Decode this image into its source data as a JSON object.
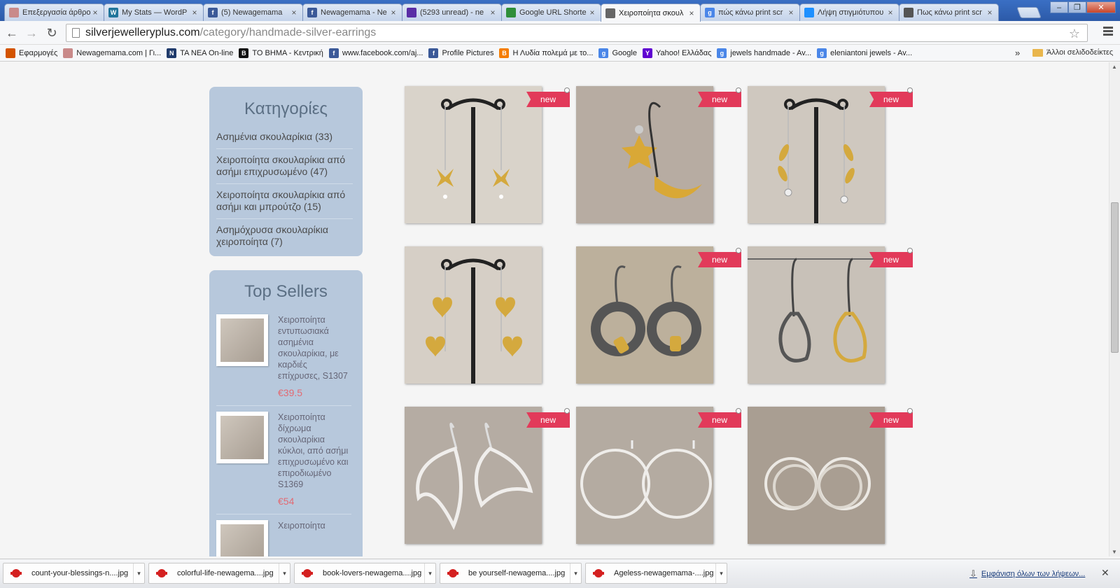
{
  "browser": {
    "tabs": [
      {
        "title": "Επεξεργασία άρθρο",
        "favicon_color": "#c98a8a"
      },
      {
        "title": "My Stats — WordP",
        "favicon_color": "#21759b",
        "favicon_text": "W"
      },
      {
        "title": "(5) Newagemama",
        "favicon_color": "#3b5998",
        "favicon_text": "f"
      },
      {
        "title": "Newagemama - Ne",
        "favicon_color": "#3b5998",
        "favicon_text": "f"
      },
      {
        "title": "(5293 unread) - ne",
        "favicon_color": "#5a2ea6"
      },
      {
        "title": "Google URL Shorte",
        "favicon_color": "#2f8f3a"
      },
      {
        "title": "Χειροποίητα σκουλ",
        "favicon_color": "#666"
      },
      {
        "title": "πώς κάνω print scr",
        "favicon_color": "#4a86e8",
        "favicon_text": "g"
      },
      {
        "title": "Λήψη στιγμιότυπου",
        "favicon_color": "#1e90ff"
      },
      {
        "title": "Πως κάνω print scr",
        "favicon_color": "#555"
      }
    ],
    "active_tab": 6,
    "url_host": "silverjewelleryplus.com",
    "url_path": "/category/handmade-silver-earrings",
    "bookmarks": [
      {
        "label": "Εφαρμογές",
        "color": "#d35400"
      },
      {
        "label": "Newagemama.com | Γι...",
        "color": "#c98a8a"
      },
      {
        "label": "ΤΑ ΝΕΑ On-line",
        "color": "#1f3a6b",
        "text": "N"
      },
      {
        "label": "ΤΟ ΒΗΜΑ - Κεντρική",
        "color": "#111",
        "text": "B"
      },
      {
        "label": "www.facebook.com/aj...",
        "color": "#3b5998",
        "text": "f"
      },
      {
        "label": "Profile Pictures",
        "color": "#3b5998",
        "text": "f"
      },
      {
        "label": "Η Λυδία πολεμά με το...",
        "color": "#f57d00",
        "text": "B"
      },
      {
        "label": "Google",
        "color": "#4a86e8",
        "text": "g"
      },
      {
        "label": "Yahoo! Ελλάδας",
        "color": "#5f01d1",
        "text": "Y"
      },
      {
        "label": "jewels handmade - Av...",
        "color": "#4a86e8",
        "text": "g"
      },
      {
        "label": "eleniantoni jewels - Av...",
        "color": "#4a86e8",
        "text": "g"
      }
    ],
    "bookmarks_more": "»",
    "other_bookmarks": "Άλλοι σελιδοδείκτες"
  },
  "sidebar": {
    "categories_title": "Κατηγορίες",
    "categories": [
      "Ασημένια σκουλαρίκια (33)",
      "Χειροποίητα σκουλαρίκια από ασήμι επιχρυσωμένο (47)",
      "Χειροποίητα σκουλαρίκια από ασήμι και μπρούτζο (15)",
      "Ασημόχρυσα σκουλαρίκια χειροποίητα (7)"
    ],
    "top_sellers_title": "Top Sellers",
    "top_sellers": [
      {
        "name": "Χειροποίητα εντυπωσιακά ασημένια σκουλαρίκια, με καρδιές επίχρυσες, S1307",
        "price": "€39.5"
      },
      {
        "name": "Χειροποίητα δίχρωμα σκουλαρίκια κύκλοι, από ασήμι επιχρυσωμένο και επιροδιωμένο S1369",
        "price": "€54"
      },
      {
        "name": "Χειροποίητα",
        "price": ""
      }
    ]
  },
  "products": {
    "badge": "new",
    "items": [
      {
        "kind": "butterfly",
        "badge": true
      },
      {
        "kind": "moon-star",
        "badge": true
      },
      {
        "kind": "leaf",
        "badge": true
      },
      {
        "kind": "hearts",
        "badge": false
      },
      {
        "kind": "ring-dark",
        "badge": true
      },
      {
        "kind": "teardrop",
        "badge": true
      },
      {
        "kind": "heart-outline",
        "badge": true
      },
      {
        "kind": "hoop",
        "badge": true
      },
      {
        "kind": "double-hoop",
        "badge": true
      }
    ]
  },
  "downloads": {
    "items": [
      "count-your-blessings-n....jpg",
      "colorful-life-newagema....jpg",
      "book-lovers-newagema....jpg",
      "be yourself-newagema....jpg",
      "Ageless-newagemama-....jpg"
    ],
    "show_all": "Εμφάνιση όλων των λήψεων..."
  }
}
